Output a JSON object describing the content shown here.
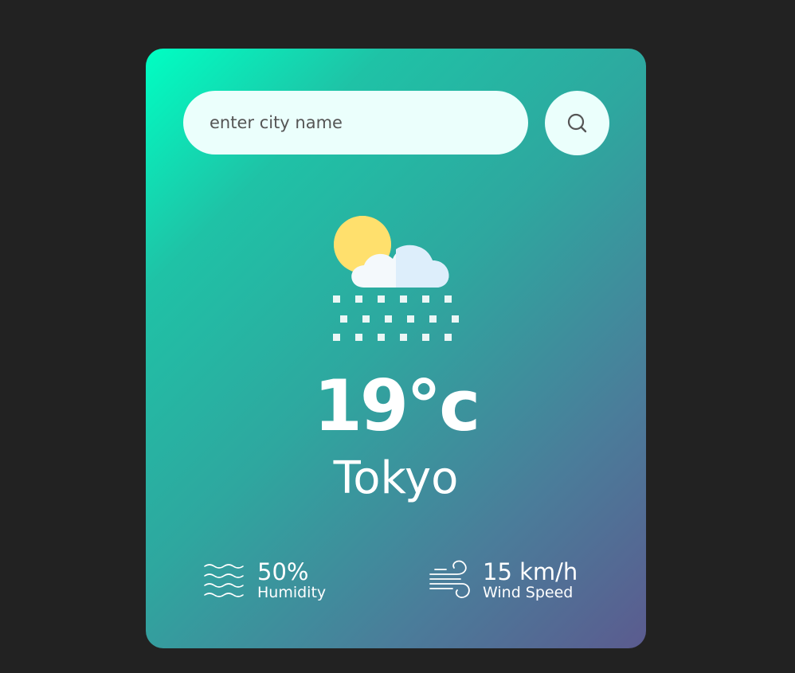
{
  "search": {
    "placeholder": "enter city name",
    "value": "",
    "button_icon": "search-icon"
  },
  "weather": {
    "icon": "cloud-sun-snow-icon",
    "temperature": "19°c",
    "city": "Tokyo"
  },
  "details": {
    "humidity": {
      "icon": "humidity-waves-icon",
      "value": "50%",
      "label": "Humidity"
    },
    "wind": {
      "icon": "wind-icon",
      "value": "15 km/h",
      "label": "Wind Speed"
    }
  },
  "colors": {
    "page_background": "#222222",
    "gradient_start": "#00ffc3",
    "gradient_end": "#5b5b8f",
    "input_background": "#ebfffc",
    "text": "#ffffff"
  }
}
